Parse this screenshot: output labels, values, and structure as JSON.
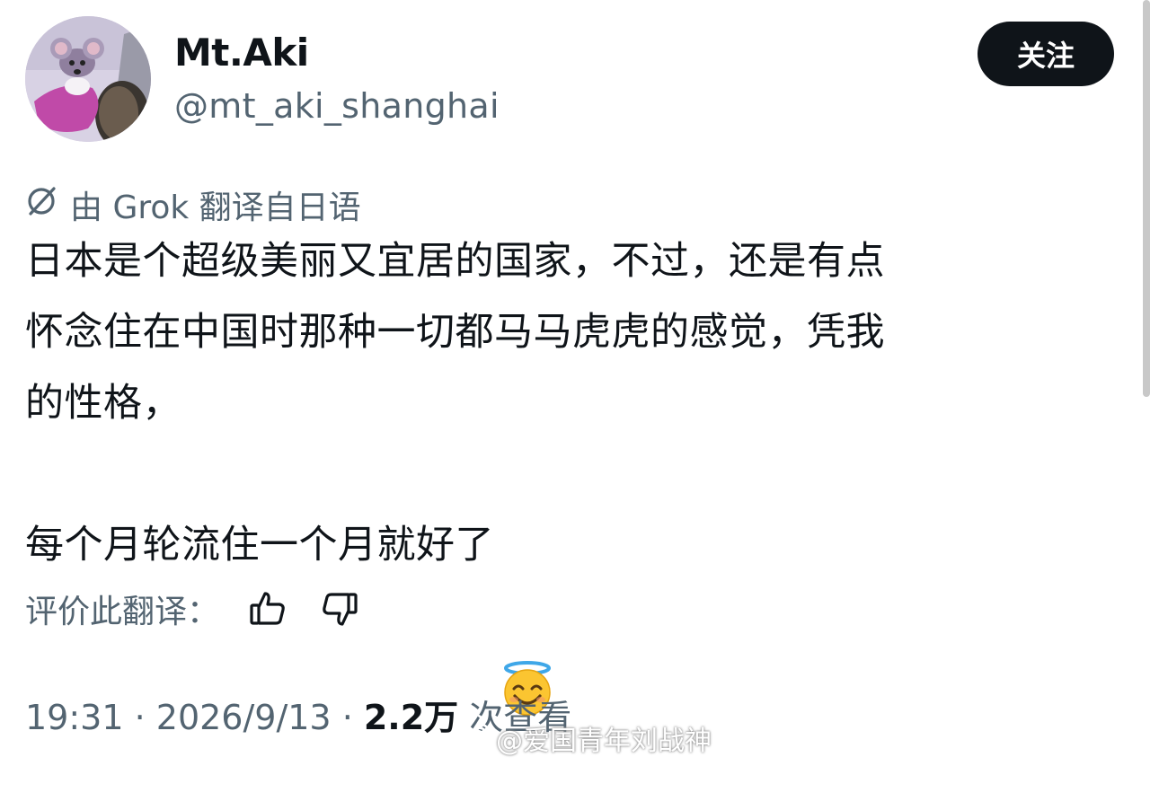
{
  "author": {
    "display_name": "Mt.Aki",
    "handle": "@mt_aki_shanghai",
    "avatar_icon": "cartoon-mouse-avatar"
  },
  "follow_button": {
    "label": "关注"
  },
  "translation": {
    "icon": "grok-icon",
    "note": "由 Grok 翻译自日语"
  },
  "tweet": {
    "lines": [
      "日本是个超级美丽又宜居的国家，不过，还是有点",
      "怀念住在中国时那种一切都马马虎虎的感觉，凭我",
      "的性格，",
      "",
      "每个月轮流住一个月就好了"
    ],
    "emoji": "smiling-face-with-halo"
  },
  "rating": {
    "label": "评价此翻译：",
    "thumbs_up_icon": "thumbs-up-icon",
    "thumbs_down_icon": "thumbs-down-icon"
  },
  "meta": {
    "time": "19:31",
    "separator": " · ",
    "date": "2026/9/13",
    "views_count": "2.2万",
    "views_label": " 次查看"
  },
  "watermark": {
    "text": "@爱国青年刘战神",
    "icon": "weibo-logo-icon"
  },
  "colors": {
    "text": "#0f1419",
    "secondary": "#536471",
    "button_bg": "#0f1419",
    "button_text": "#ffffff"
  }
}
